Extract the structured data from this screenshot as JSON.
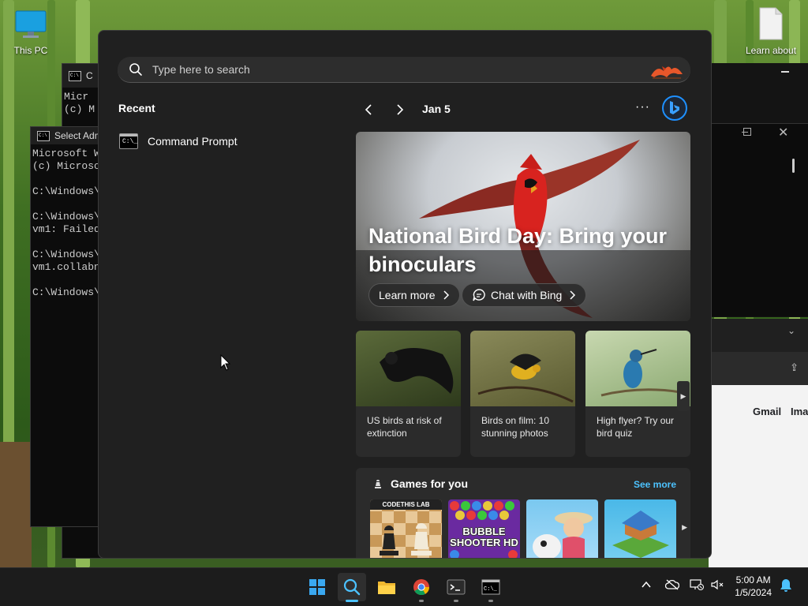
{
  "desktop": {
    "icons": [
      {
        "label": "This PC"
      },
      {
        "label": "Learn about"
      }
    ]
  },
  "background_windows": {
    "cmd_back": {
      "title": "C",
      "lines": [
        "Micr",
        "(c) M"
      ]
    },
    "cmd_front": {
      "title": "Select Adm",
      "lines": [
        "Microsoft W",
        "(c) Microso",
        "",
        "C:\\Windows\\",
        "",
        "C:\\Windows\\",
        "vm1: Failed",
        "",
        "C:\\Windows\\",
        "vm1.collabn",
        "",
        "C:\\Windows\\"
      ]
    },
    "browser": {
      "links": [
        "Gmail",
        "Ima"
      ]
    }
  },
  "search": {
    "placeholder": "Type here to search"
  },
  "recent": {
    "heading": "Recent",
    "items": [
      {
        "label": "Command Prompt",
        "icon": "command-prompt-icon"
      }
    ]
  },
  "feed": {
    "date": "Jan 5",
    "more": "···",
    "hero": {
      "title": "National Bird Day: Bring your binoculars",
      "learn_more": "Learn more",
      "chat": "Chat with Bing"
    },
    "cards": [
      {
        "caption": "US birds at risk of extinction"
      },
      {
        "caption": "Birds on film: 10 stunning photos"
      },
      {
        "caption": "High flyer? Try our bird quiz"
      }
    ],
    "games": {
      "heading": "Games for you",
      "see_more": "See more",
      "tiles": [
        {
          "label": "CODETHIS LAB"
        },
        {
          "label": "BUBBLE SHOOTER HD"
        },
        {
          "label": ""
        },
        {
          "label": ""
        }
      ]
    }
  },
  "taskbar": {
    "apps": [
      "start-icon",
      "search-icon",
      "file-explorer-icon",
      "chrome-icon",
      "terminal-icon",
      "command-prompt-icon"
    ],
    "time": "5:00 AM",
    "date": "1/5/2024"
  },
  "colors": {
    "accent": "#4cc2ff",
    "flyout_bg": "#202020",
    "card_bg": "#2b2b2b",
    "taskbar_bg": "#1c1c1c"
  }
}
